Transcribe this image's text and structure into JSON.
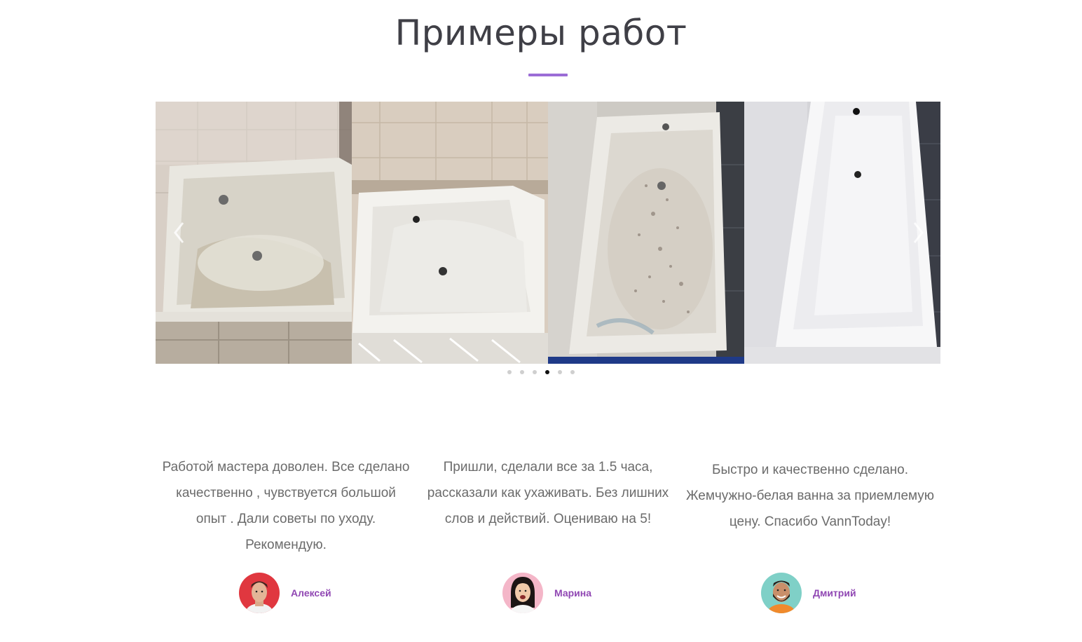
{
  "section": {
    "title": "Примеры работ",
    "accent_color": "#9b6cd6"
  },
  "gallery": {
    "slides": [
      {
        "alt": "bathtub-before-corner"
      },
      {
        "alt": "bathtub-after-corner"
      },
      {
        "alt": "bathtub-before-long"
      },
      {
        "alt": "bathtub-after-long"
      }
    ],
    "dots_count": 6,
    "active_dot": 3,
    "prev_icon": "chevron-left-icon",
    "next_icon": "chevron-right-icon"
  },
  "reviews": [
    {
      "text": "Работой мастера доволен. Все сделано качественно , чувствуется большой опыт . Дали советы по уходу. Рекомендую.",
      "author": "Алексей",
      "avatar_bg": "#e0373f"
    },
    {
      "text": "Пришли, сделали все за 1.5 часа, рассказали как ухаживать. Без лишних слов и действий. Оцениваю на 5!",
      "author": "Марина",
      "avatar_bg": "#f4b6c8"
    },
    {
      "text": "Быстро и качественно сделано. Жемчужно-белая ванна за приемлемую цену. Спасибо VannToday!",
      "author": "Дмитрий",
      "avatar_bg": "#7fd0c7"
    }
  ],
  "colors": {
    "author_name": "#9047b3",
    "review_text": "#6b6b6b",
    "title": "#3f3f46"
  }
}
